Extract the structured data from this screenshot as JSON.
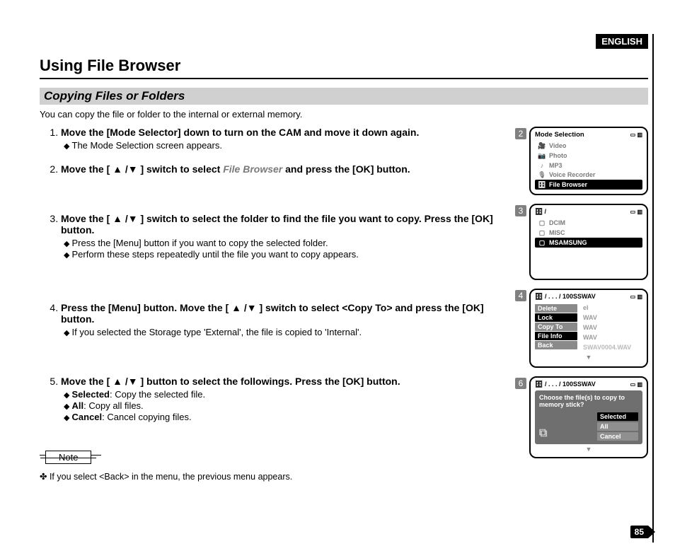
{
  "language_tag": "ENGLISH",
  "page_title": "Using File Browser",
  "section_title": "Copying Files or Folders",
  "intro": "You can copy the file or folder to the internal or external memory.",
  "steps": [
    {
      "head_before": "Move the [Mode Selector] down to turn on the CAM and move it down again.",
      "subs": [
        "The Mode Selection screen appears."
      ]
    },
    {
      "head_plain_a": "Move the [ ▲ /▼ ] switch to select ",
      "head_grey": "File Browser",
      "head_plain_b": " and press the [OK] button."
    },
    {
      "head_before": "Move the [ ▲ /▼ ] switch to select the folder to find the file you want to copy. Press the [OK] button.",
      "subs": [
        "Press the [Menu] button if you want to copy the selected folder.",
        "Perform these steps repeatedly until the file you want to copy appears."
      ]
    },
    {
      "head_before": "Press the [Menu] button. Move the [ ▲ /▼ ] switch to select <Copy To> and press the [OK] button.",
      "subs": [
        "If you selected the Storage type 'External', the file is copied to 'Internal'."
      ]
    },
    {
      "head_before": "Move the [ ▲ /▼ ] button to select the followings. Press the [OK] button.",
      "subs_kv": [
        {
          "k": "Selected",
          "v": ": Copy the selected file."
        },
        {
          "k": "All",
          "v": ": Copy all files."
        },
        {
          "k": "Cancel",
          "v": ": Cancel copying files."
        }
      ]
    }
  ],
  "note_label": "Note",
  "note_text": "If you select <Back> in the menu, the previous menu appears.",
  "page_number": "85",
  "shots": {
    "s2": {
      "num": "2",
      "title": "Mode Selection",
      "items": [
        "Video",
        "Photo",
        "MP3",
        "Voice Recorder",
        "File Browser"
      ],
      "icons": [
        "🎥",
        "📷",
        "♪",
        "🎙",
        "🗄"
      ]
    },
    "s3": {
      "num": "3",
      "path_icon": "🗄",
      "path": "/",
      "folders": [
        "DCIM",
        "MISC",
        "MSAMSUNG"
      ]
    },
    "s4": {
      "num": "4",
      "path": "/ . . . / 100SSWAV",
      "menu": [
        "Delete",
        "Lock",
        "Copy To",
        "File Info",
        "Back"
      ],
      "files": [
        "el",
        "WAV",
        "WAV",
        "WAV",
        "SWAV0004.WAV"
      ]
    },
    "s6": {
      "num": "6",
      "path": "/ . . . / 100SSWAV",
      "dialog_q": "Choose the file(s) to copy to memory stick?",
      "options": [
        "Selected",
        "All",
        "Cancel"
      ]
    }
  }
}
